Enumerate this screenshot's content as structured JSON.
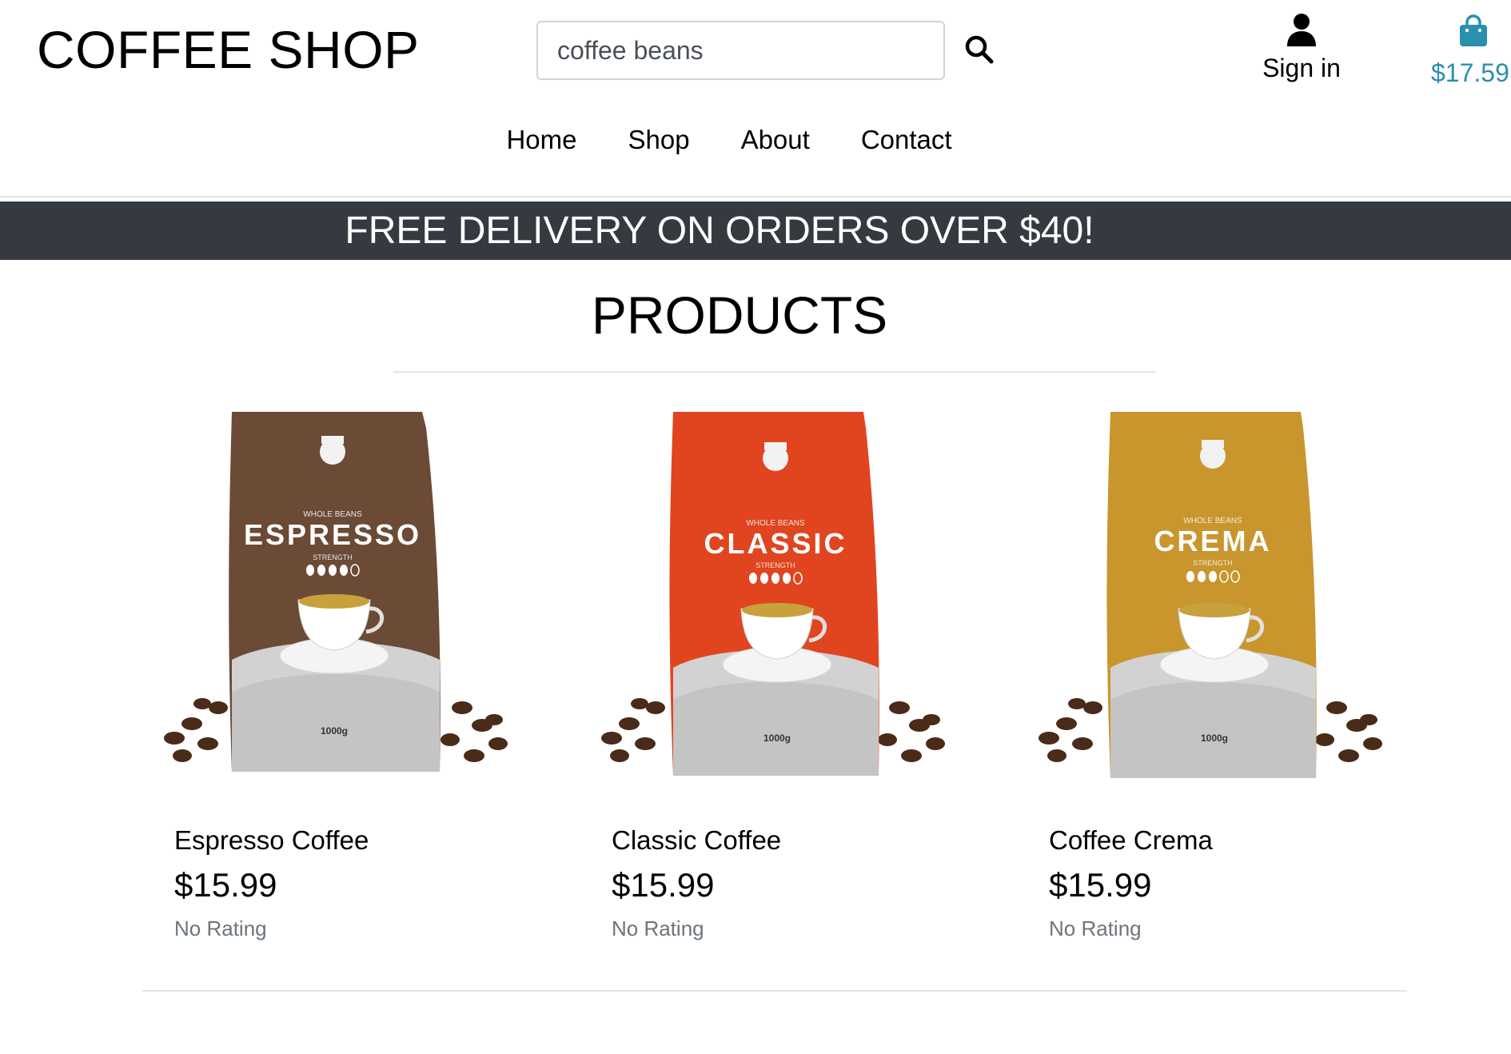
{
  "brand": {
    "name": "COFFEE SHOP"
  },
  "search": {
    "value": "coffee beans",
    "icon": "search-icon"
  },
  "account": {
    "label": "Sign in",
    "icon": "user-icon"
  },
  "bag": {
    "total": "$17.59",
    "icon": "shopping-bag-icon",
    "color": "#2b8fae"
  },
  "nav": {
    "items": [
      "Home",
      "Shop",
      "About",
      "Contact"
    ]
  },
  "banner": {
    "text": "FREE DELIVERY ON ORDERS OVER $40!",
    "background": "#343a40"
  },
  "products": {
    "title": "PRODUCTS",
    "items": [
      {
        "name": "Espresso Coffee",
        "price": "$15.99",
        "rating": "No Rating",
        "pack": {
          "label": "ESPRESSO",
          "subtitle": "WHOLE BEANS",
          "strength_label": "STRENGTH",
          "weight": "1000g",
          "color": "#6b4a36"
        }
      },
      {
        "name": "Classic Coffee",
        "price": "$15.99",
        "rating": "No Rating",
        "pack": {
          "label": "CLASSIC",
          "subtitle": "WHOLE BEANS",
          "strength_label": "STRENGTH",
          "weight": "1000g",
          "color": "#e0451f"
        }
      },
      {
        "name": "Coffee Crema",
        "price": "$15.99",
        "rating": "No Rating",
        "pack": {
          "label": "CREMA",
          "subtitle": "WHOLE BEANS",
          "strength_label": "STRENGTH",
          "weight": "1000g",
          "color": "#c9962e"
        }
      }
    ]
  }
}
